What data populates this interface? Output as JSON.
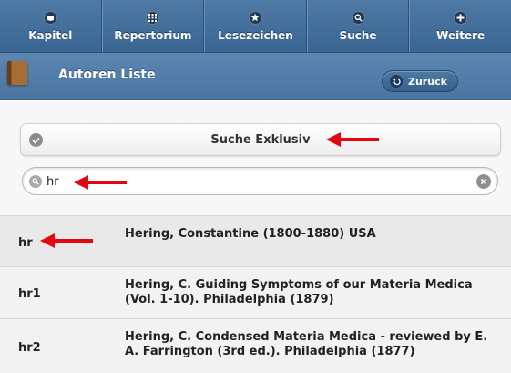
{
  "navbar": {
    "items": [
      {
        "label": "Kapitel",
        "icon": "book-open-icon"
      },
      {
        "label": "Repertorium",
        "icon": "grid-icon"
      },
      {
        "label": "Lesezeichen",
        "icon": "star-icon"
      },
      {
        "label": "Suche",
        "icon": "search-icon"
      },
      {
        "label": "Weitere",
        "icon": "plus-icon"
      }
    ]
  },
  "header": {
    "title": "Autoren Liste",
    "back_label": "Zurück"
  },
  "filter": {
    "toggle_label": "Suche Exklusiv",
    "search_value": "hr"
  },
  "results": [
    {
      "code": "hr",
      "text": "Hering, Constantine (1800-1880) USA"
    },
    {
      "code": "hr1",
      "text": "Hering, C. Guiding Symptoms of our Materia Medica (Vol. 1-10). Philadelphia (1879)"
    },
    {
      "code": "hr2",
      "text": "Hering, C. Condensed Materia Medica - reviewed by E. A. Farrington (3rd ed.). Philadelphia (1877)"
    }
  ],
  "colors": {
    "nav_bg": "#3f6a96",
    "header_bg": "#5580ac",
    "annotation_arrow": "#e30613"
  }
}
